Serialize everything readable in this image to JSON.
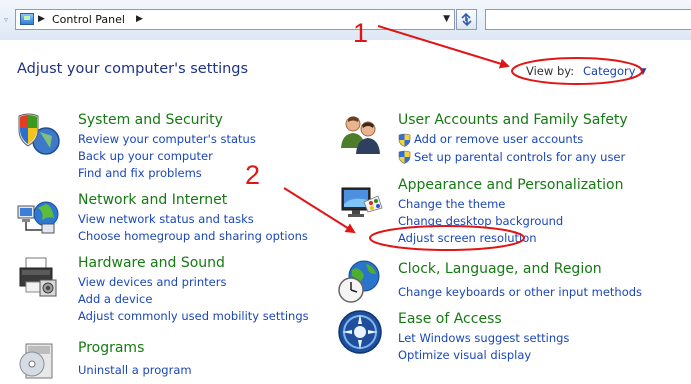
{
  "window": {
    "breadcrumb": "Control Panel",
    "search_placeholder": ""
  },
  "header": {
    "title": "Adjust your computer's settings",
    "view_by_label": "View by:",
    "view_by_value": "Category"
  },
  "categories": [
    {
      "title": "System and Security",
      "icon": "shield-computer-icon",
      "links": [
        "Review your computer's status",
        "Back up your computer",
        "Find and fix problems"
      ]
    },
    {
      "title": "Network and Internet",
      "icon": "network-globe-icon",
      "links": [
        "View network status and tasks",
        "Choose homegroup and sharing options"
      ]
    },
    {
      "title": "Hardware and Sound",
      "icon": "printer-icon",
      "links": [
        "View devices and printers",
        "Add a device",
        "Adjust commonly used mobility settings"
      ]
    },
    {
      "title": "Programs",
      "icon": "programs-disc-icon",
      "links": [
        "Uninstall a program"
      ]
    },
    {
      "title": "User Accounts and Family Safety",
      "icon": "users-icon",
      "links": [
        "Add or remove user accounts",
        "Set up parental controls for any user"
      ]
    },
    {
      "title": "Appearance and Personalization",
      "icon": "monitor-palette-icon",
      "links": [
        "Change the theme",
        "Change desktop background",
        "Adjust screen resolution"
      ]
    },
    {
      "title": "Clock, Language, and Region",
      "icon": "globe-clock-icon",
      "links": [
        "Change keyboards or other input methods"
      ]
    },
    {
      "title": "Ease of Access",
      "icon": "ease-of-access-icon",
      "links": [
        "Let Windows suggest settings",
        "Optimize visual display"
      ]
    }
  ],
  "annotations": {
    "step1": "1",
    "step2": "2",
    "color": "#e01616"
  }
}
